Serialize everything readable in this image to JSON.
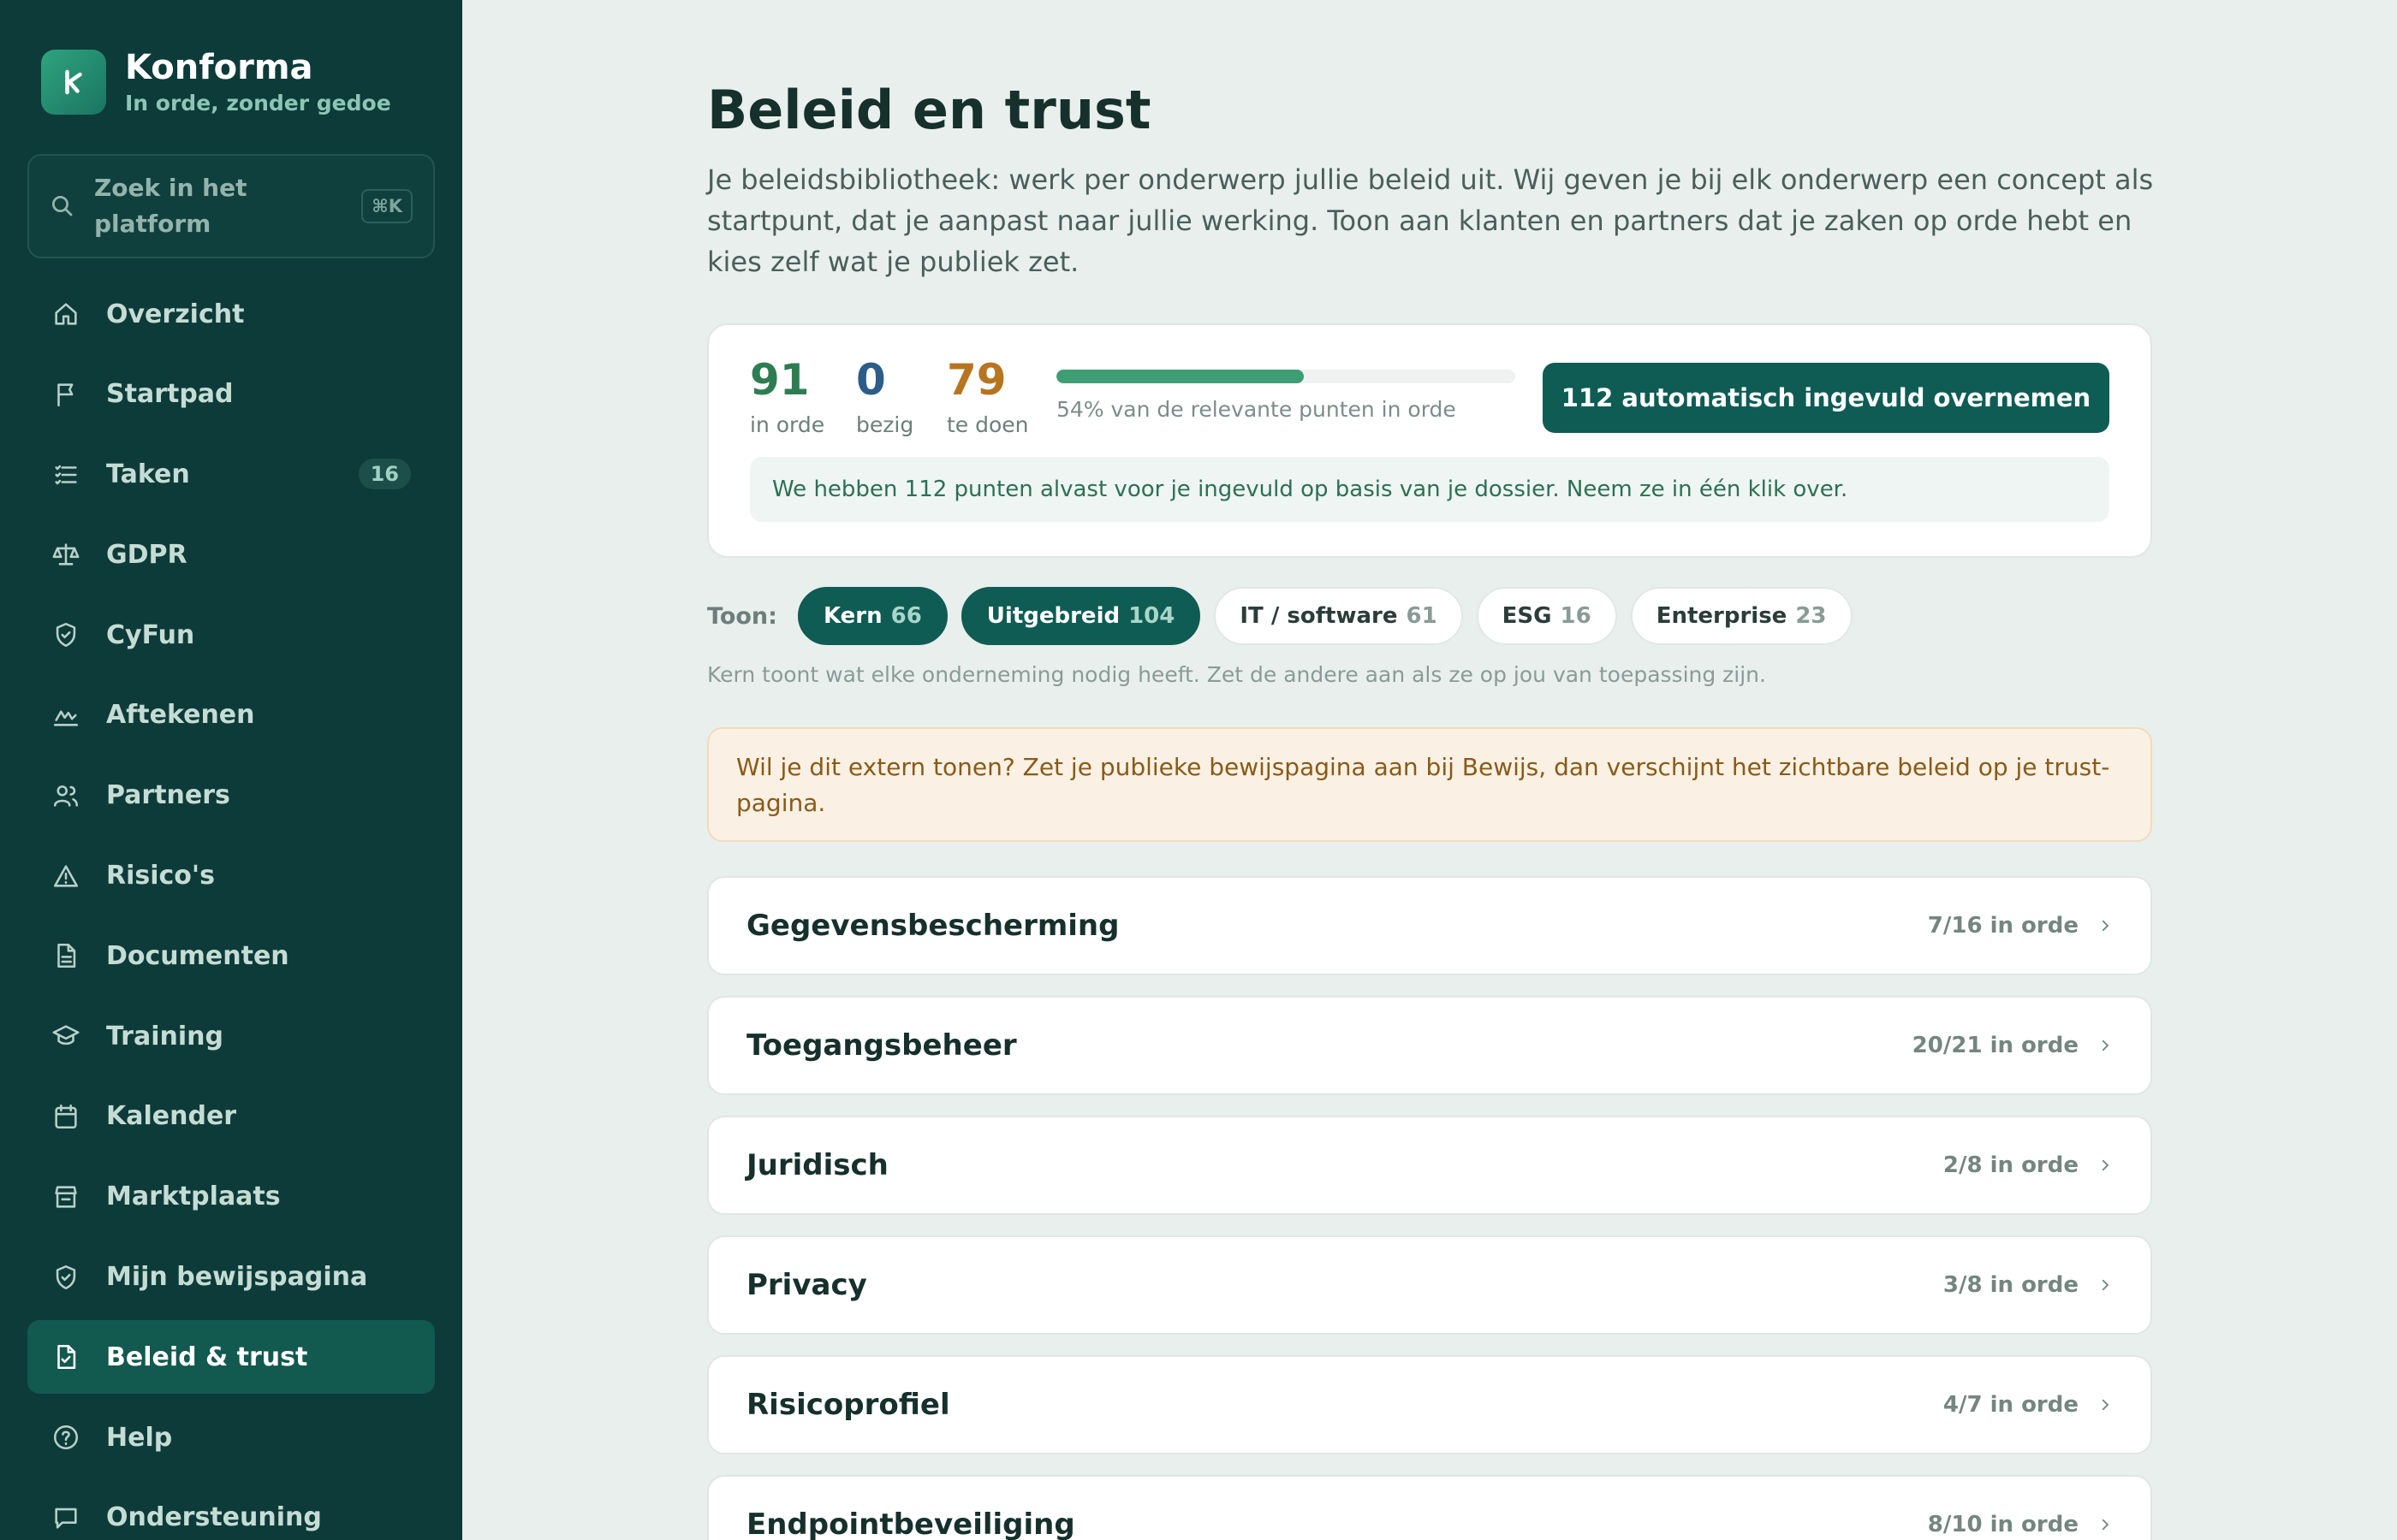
{
  "brand": {
    "name": "Konforma",
    "tagline": "In orde, zonder gedoe"
  },
  "search": {
    "placeholder": "Zoek in het platform",
    "shortcut": "⌘K"
  },
  "nav": [
    {
      "label": "Overzicht",
      "icon": "home-icon"
    },
    {
      "label": "Startpad",
      "icon": "flag-icon"
    },
    {
      "label": "Taken",
      "icon": "list-icon",
      "badge": "16"
    },
    {
      "label": "GDPR",
      "icon": "scale-icon"
    },
    {
      "label": "CyFun",
      "icon": "shield-icon"
    },
    {
      "label": "Aftekenen",
      "icon": "signature-icon"
    },
    {
      "label": "Partners",
      "icon": "users-icon"
    },
    {
      "label": "Risico's",
      "icon": "warning-icon"
    },
    {
      "label": "Documenten",
      "icon": "document-icon"
    },
    {
      "label": "Training",
      "icon": "graduation-cap-icon"
    },
    {
      "label": "Kalender",
      "icon": "calendar-icon"
    },
    {
      "label": "Marktplaats",
      "icon": "store-icon"
    },
    {
      "label": "Mijn bewijspagina",
      "icon": "shield-check-icon"
    },
    {
      "label": "Beleid & trust",
      "icon": "document-check-icon",
      "active": true
    },
    {
      "label": "Help",
      "icon": "help-circle-icon"
    },
    {
      "label": "Ondersteuning",
      "icon": "chat-icon"
    }
  ],
  "page": {
    "title": "Beleid en trust",
    "intro": "Je beleidsbibliotheek: werk per onderwerp jullie beleid uit. Wij geven je bij elk onderwerp een concept als startpunt, dat je aanpast naar jullie werking. Toon aan klanten en partners dat je zaken op orde hebt en kies zelf wat je publiek zet."
  },
  "stats": {
    "in_orde": {
      "value": "91",
      "label": "in orde",
      "color": "#2e7d52"
    },
    "bezig": {
      "value": "0",
      "label": "bezig",
      "color": "#2b5c8a"
    },
    "te_doen": {
      "value": "79",
      "label": "te doen",
      "color": "#b7751f"
    },
    "progress_percent": 54,
    "progress_text": "54% van de relevante punten in orde",
    "cta_label": "112 automatisch ingevuld overnemen",
    "notice": "We hebben 112 punten alvast voor je ingevuld op basis van je dossier. Neem ze in één klik over."
  },
  "filters": {
    "label": "Toon:",
    "chips": [
      {
        "label": "Kern",
        "count": "66",
        "active": true
      },
      {
        "label": "Uitgebreid",
        "count": "104",
        "active": true
      },
      {
        "label": "IT / software",
        "count": "61",
        "active": false
      },
      {
        "label": "ESG",
        "count": "16",
        "active": false
      },
      {
        "label": "Enterprise",
        "count": "23",
        "active": false
      }
    ],
    "hint": "Kern toont wat elke onderneming nodig heeft. Zet de andere aan als ze op jou van toepassing zijn."
  },
  "warning": "Wil je dit extern tonen? Zet je publieke bewijspagina aan bij Bewijs, dan verschijnt het zichtbare beleid op je trust-pagina.",
  "topics": [
    {
      "name": "Gegevensbescherming",
      "status": "7/16 in orde"
    },
    {
      "name": "Toegangsbeheer",
      "status": "20/21 in orde"
    },
    {
      "name": "Juridisch",
      "status": "2/8 in orde"
    },
    {
      "name": "Privacy",
      "status": "3/8 in orde"
    },
    {
      "name": "Risicoprofiel",
      "status": "4/7 in orde"
    },
    {
      "name": "Endpointbeveiliging",
      "status": "8/10 in orde"
    }
  ]
}
